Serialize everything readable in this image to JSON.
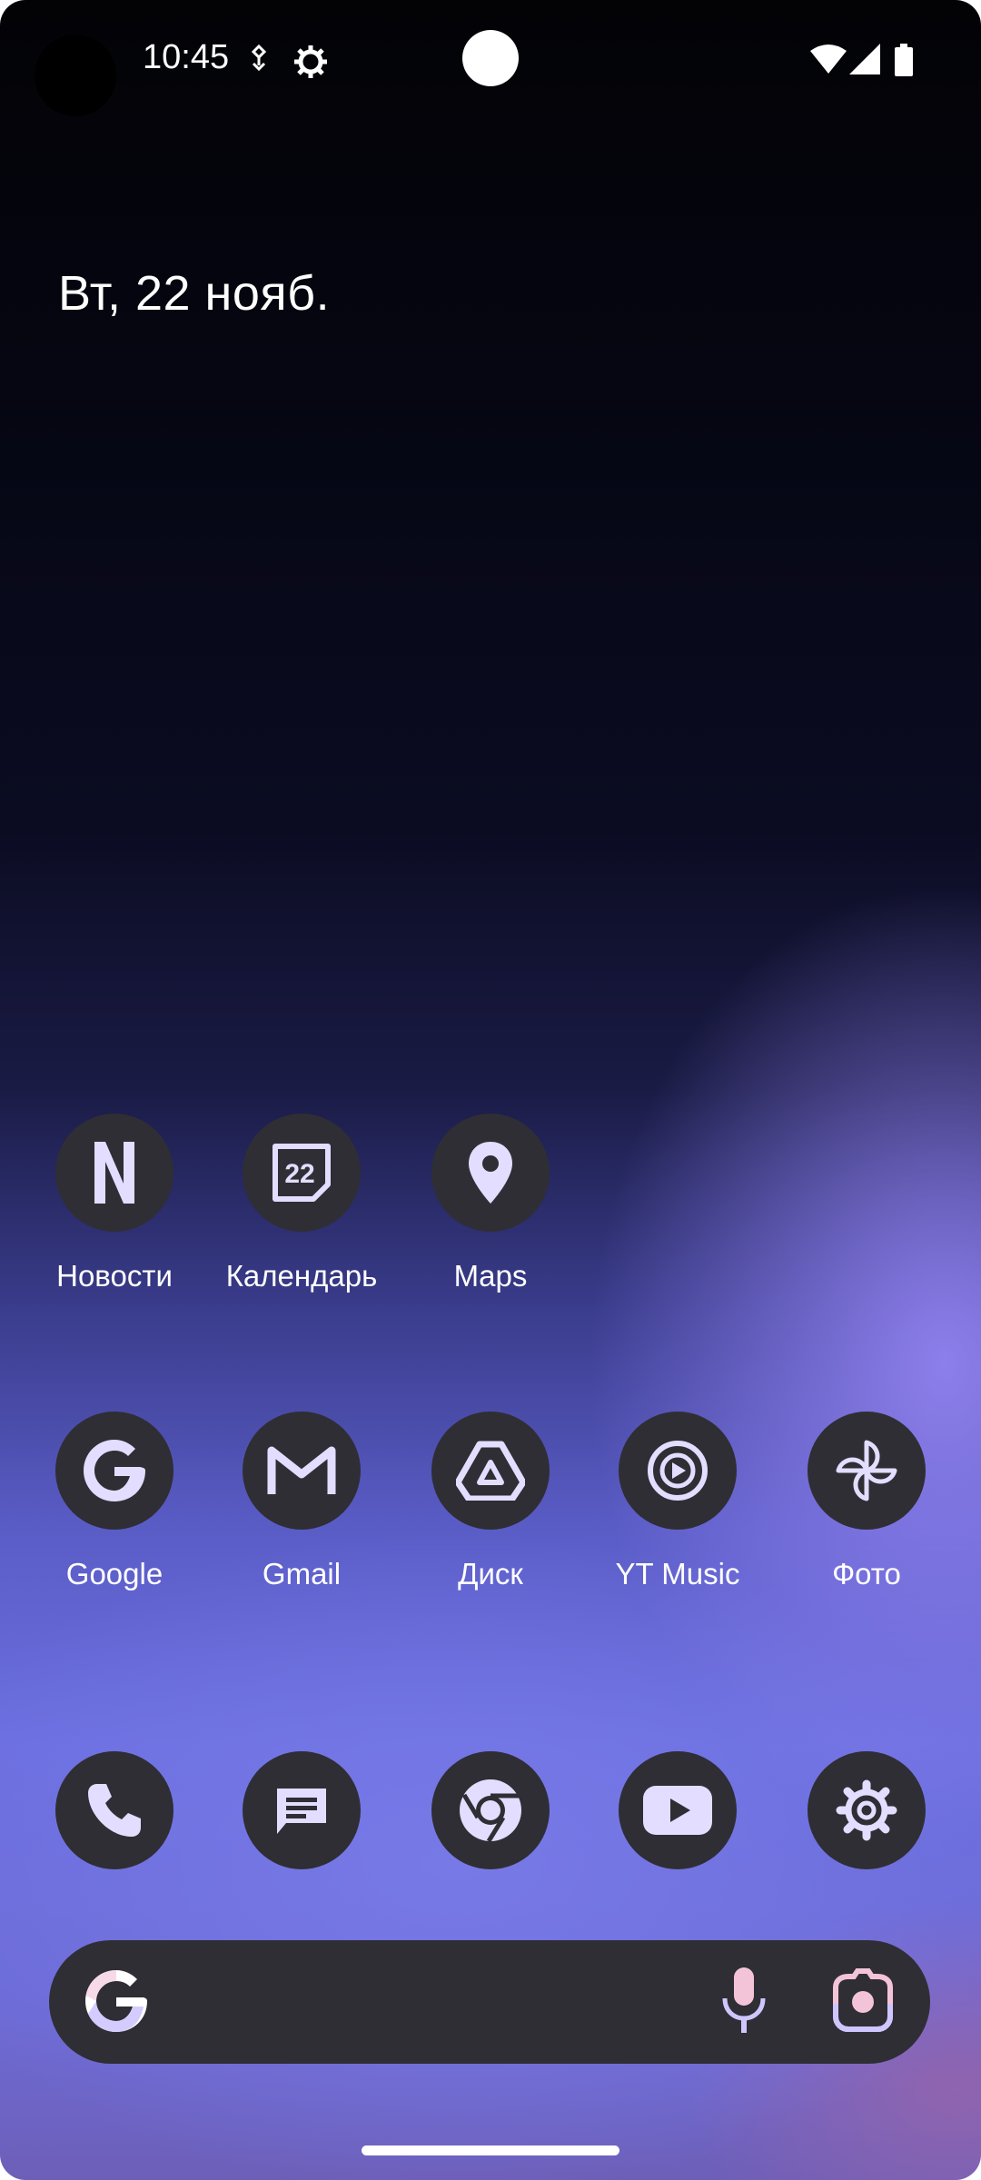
{
  "status_bar": {
    "time": "10:45"
  },
  "home": {
    "date": "Вт, 22 нояб."
  },
  "apps_row1": [
    {
      "label": "Новости",
      "icon": "news-icon"
    },
    {
      "label": "Календарь",
      "icon": "calendar-icon",
      "icon_text": "22"
    },
    {
      "label": "Maps",
      "icon": "maps-pin-icon"
    }
  ],
  "apps_row2": [
    {
      "label": "Google",
      "icon": "google-icon"
    },
    {
      "label": "Gmail",
      "icon": "gmail-icon"
    },
    {
      "label": "Диск",
      "icon": "drive-icon"
    },
    {
      "label": "YT Music",
      "icon": "yt-music-icon"
    },
    {
      "label": "Фото",
      "icon": "photos-icon"
    }
  ],
  "dock": [
    {
      "icon": "phone-icon"
    },
    {
      "icon": "messages-icon"
    },
    {
      "icon": "chrome-icon"
    },
    {
      "icon": "youtube-icon"
    },
    {
      "icon": "settings-icon"
    }
  ],
  "colors": {
    "icon_bg": "#2f2e34",
    "icon_fg": "#e3ddff",
    "accent": "#8b7fe8"
  }
}
